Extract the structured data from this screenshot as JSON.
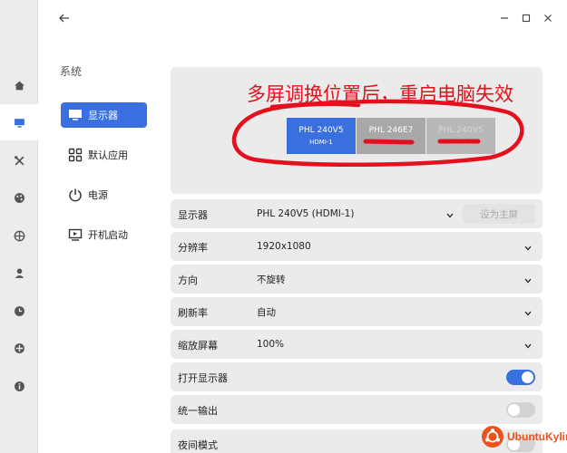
{
  "sidebar": {
    "section_title": "系统",
    "items": [
      {
        "label": "显示器"
      },
      {
        "label": "默认应用"
      },
      {
        "label": "电源"
      },
      {
        "label": "开机启动"
      }
    ]
  },
  "preview": {
    "monitors": [
      {
        "name": "PHL 240V5",
        "port": "HDMI-1"
      },
      {
        "name": "PHL 246E7",
        "port": "DVI-1-0"
      },
      {
        "name": "PHL 240V5",
        "port": "DVI-1-0"
      }
    ],
    "annotation": "多屏调换位置后，重启电脑失效"
  },
  "settings": {
    "display": {
      "label": "显示器",
      "value": "PHL 240V5 (HDMI-1)",
      "button": "设为主屏"
    },
    "resolution": {
      "label": "分辨率",
      "value": "1920x1080"
    },
    "orientation": {
      "label": "方向",
      "value": "不旋转"
    },
    "refresh": {
      "label": "刷新率",
      "value": "自动"
    },
    "scale": {
      "label": "缩放屏幕",
      "value": "100%"
    },
    "open_display": {
      "label": "打开显示器",
      "on": true
    },
    "unified_output": {
      "label": "统一输出",
      "on": false
    },
    "night_mode": {
      "label": "夜间模式",
      "on": false
    }
  },
  "watermark": {
    "text": "UbuntuKylin"
  },
  "colors": {
    "accent": "#3a6fe0",
    "annotation": "#e4101e",
    "brand": "#e8541c"
  }
}
